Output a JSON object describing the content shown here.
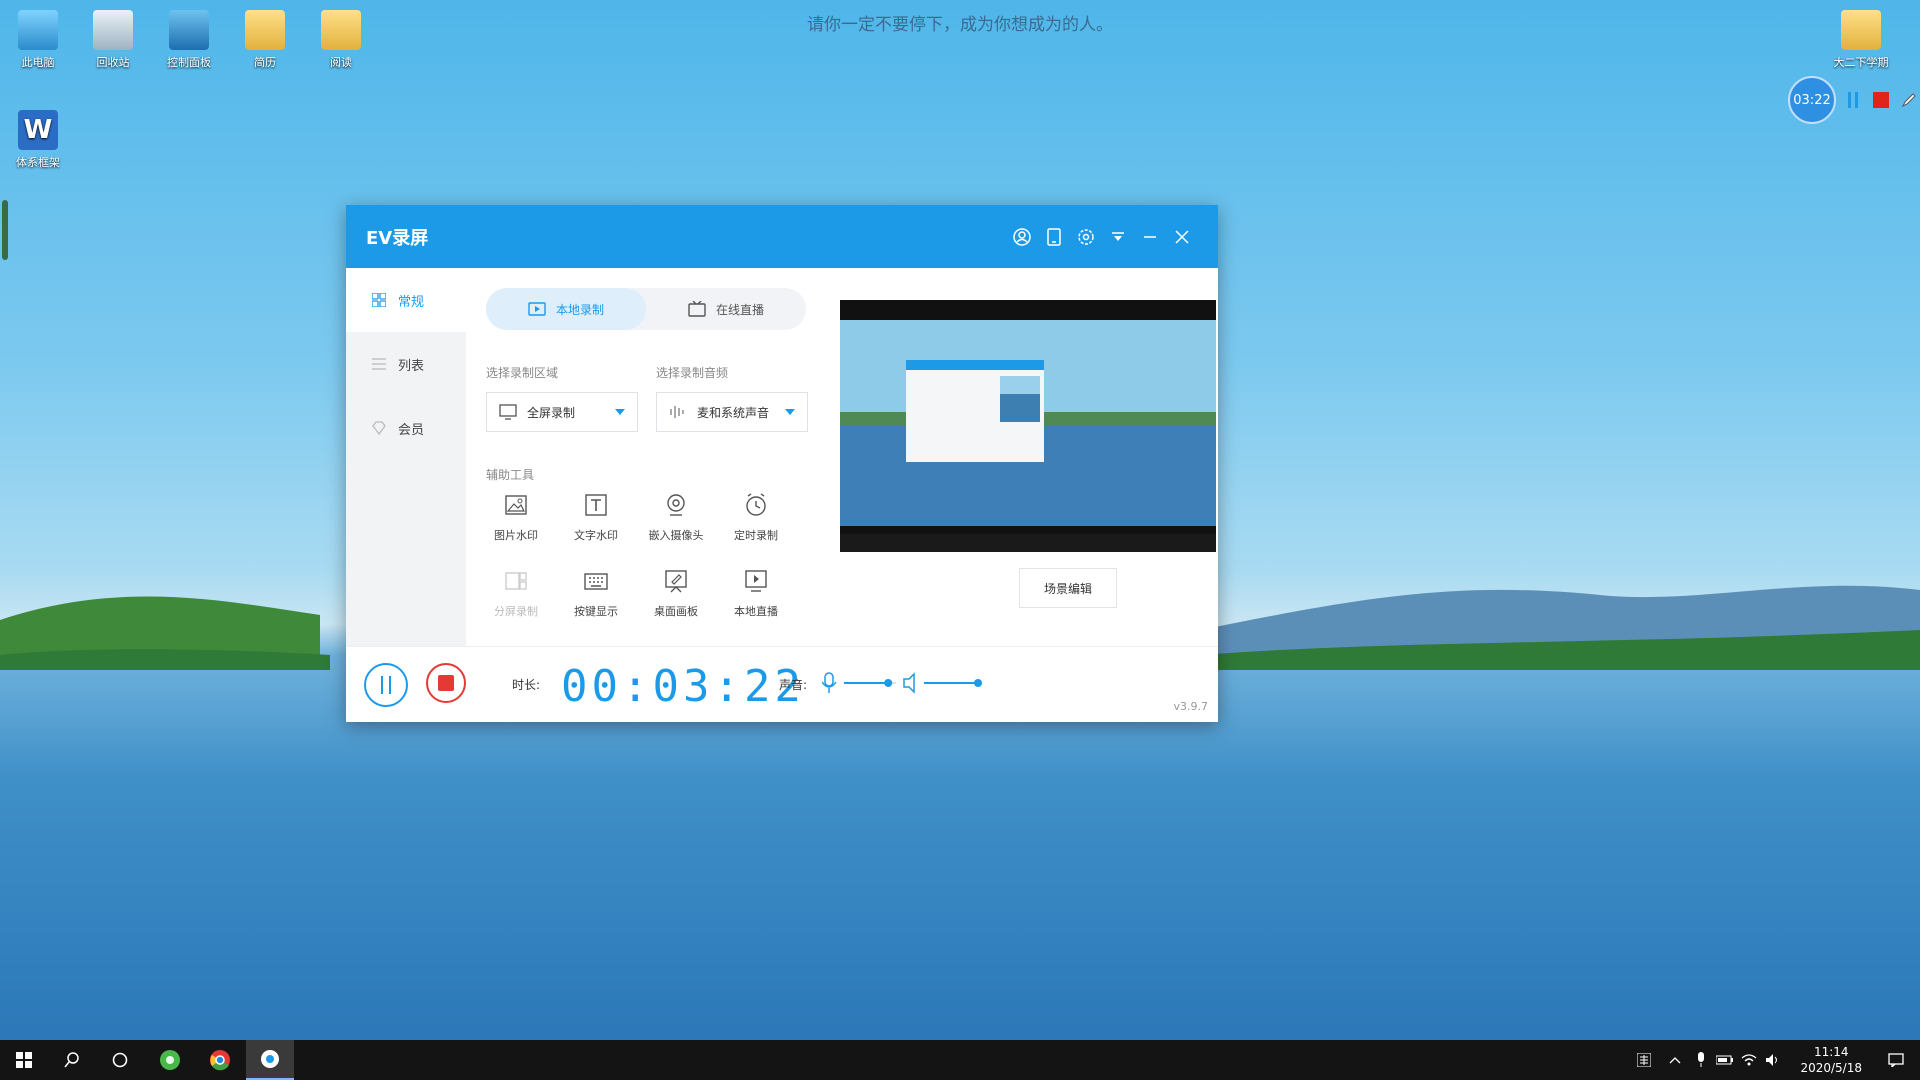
{
  "desktop": {
    "quote": "请你一定不要停下，成为你想成为的人。",
    "icons": [
      {
        "label": "此电脑",
        "icon": "computer-icon"
      },
      {
        "label": "回收站",
        "icon": "recycle-bin-icon"
      },
      {
        "label": "控制面板",
        "icon": "control-panel-icon"
      },
      {
        "label": "简历",
        "icon": "folder-icon"
      },
      {
        "label": "阅读",
        "icon": "folder-icon"
      },
      {
        "label": "体系框架",
        "icon": "word-icon"
      },
      {
        "label": "大二下学期",
        "icon": "folder-icon"
      }
    ]
  },
  "recorder_float": {
    "time": "03:22",
    "pause_icon": "pause-icon",
    "stop_icon": "stop-icon",
    "pen_icon": "pen-icon"
  },
  "app": {
    "title": "EV录屏",
    "title_icons": [
      "user-icon",
      "tablet-icon",
      "settings-icon",
      "dropdown-icon",
      "minimize-icon",
      "close-icon"
    ],
    "nav": [
      {
        "label": "常规",
        "icon": "grid-icon",
        "active": true
      },
      {
        "label": "列表",
        "icon": "list-icon",
        "active": false
      },
      {
        "label": "会员",
        "icon": "diamond-icon",
        "active": false
      }
    ],
    "tabs": [
      {
        "label": "本地录制",
        "icon": "video-icon",
        "active": true
      },
      {
        "label": "在线直播",
        "icon": "live-icon",
        "active": false
      }
    ],
    "area_label": "选择录制区域",
    "area_value": "全屏录制",
    "audio_label": "选择录制音频",
    "audio_value": "麦和系统声音",
    "tools_label": "辅助工具",
    "tools": [
      {
        "label": "图片水印",
        "icon": "image-icon",
        "enabled": true
      },
      {
        "label": "文字水印",
        "icon": "text-icon",
        "enabled": true
      },
      {
        "label": "嵌入摄像头",
        "icon": "camera-icon",
        "enabled": true
      },
      {
        "label": "定时录制",
        "icon": "clock-icon",
        "enabled": true
      },
      {
        "label": "分屏录制",
        "icon": "split-screen-icon",
        "enabled": false
      },
      {
        "label": "按键显示",
        "icon": "keyboard-icon",
        "enabled": true
      },
      {
        "label": "桌面画板",
        "icon": "drawing-board-icon",
        "enabled": true
      },
      {
        "label": "本地直播",
        "icon": "local-live-icon",
        "enabled": true
      }
    ],
    "scene_button": "场景编辑",
    "duration_label": "时长:",
    "duration": "00:03:22",
    "sound_label": "声音:",
    "mic_level": 0.85,
    "speaker_level": 1.0,
    "version": "v3.9.7"
  },
  "taskbar": {
    "time": "11:14",
    "date": "2020/5/18"
  },
  "colors": {
    "accent": "#1c9ae8",
    "stop": "#e53935",
    "taskbar": "#141414"
  }
}
